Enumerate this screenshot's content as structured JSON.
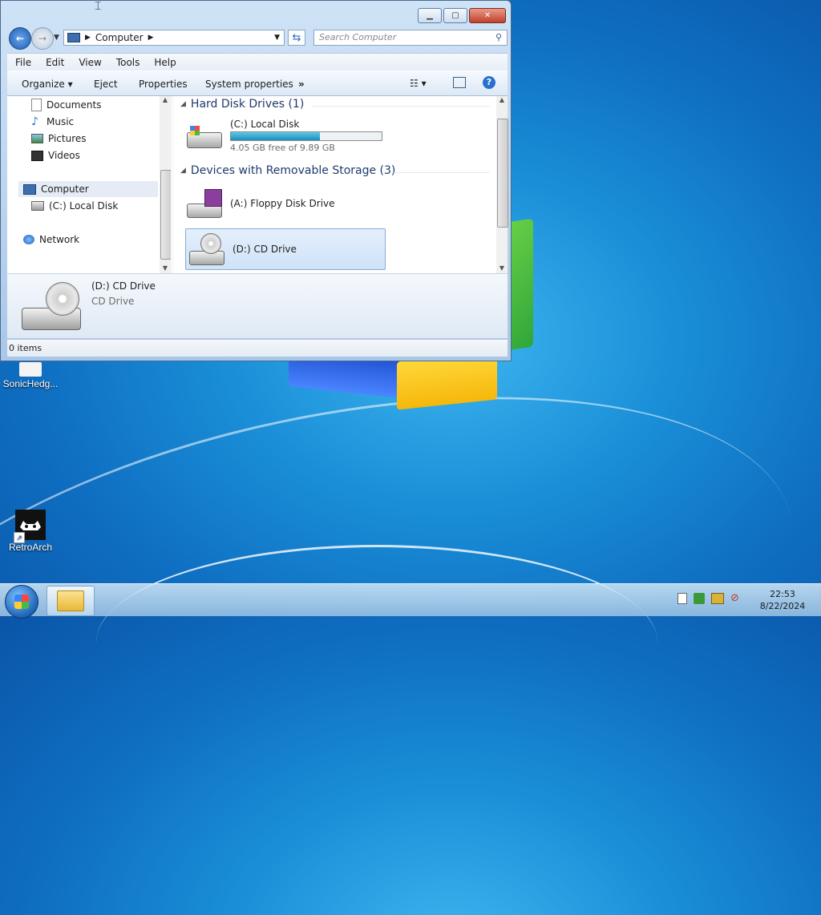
{
  "desktop": {
    "icons": [
      {
        "label": "SonicHedg..."
      },
      {
        "label": "RetroArch"
      }
    ]
  },
  "window": {
    "address": {
      "root_label": "Computer"
    },
    "search": {
      "placeholder": "Search Computer"
    },
    "menu": [
      "File",
      "Edit",
      "View",
      "Tools",
      "Help"
    ],
    "toolbar": {
      "organize": "Organize",
      "eject": "Eject",
      "properties": "Properties",
      "system_properties": "System properties",
      "more": "»"
    },
    "nav_pane": {
      "items": [
        "Documents",
        "Music",
        "Pictures",
        "Videos",
        "Computer",
        "(C:) Local Disk",
        "Network"
      ]
    },
    "groups": [
      {
        "title": "Hard Disk Drives (1)"
      },
      {
        "title": "Devices with Removable Storage (3)"
      }
    ],
    "drives": {
      "c": {
        "name": "(C:) Local Disk",
        "free": "4.05 GB free of 9.89 GB",
        "used_fraction": 0.59
      },
      "a": {
        "name": "(A:) Floppy Disk Drive"
      },
      "d": {
        "name": "(D:) CD Drive"
      }
    },
    "details": {
      "name": "(D:) CD Drive",
      "type": "CD Drive"
    },
    "status": "0 items"
  },
  "taskbar": {
    "time": "22:53",
    "date": "8/22/2024"
  },
  "colors": {
    "accent": "#1b8dbd",
    "selection": "#cfe3f8",
    "close_button": "#c2402a"
  }
}
